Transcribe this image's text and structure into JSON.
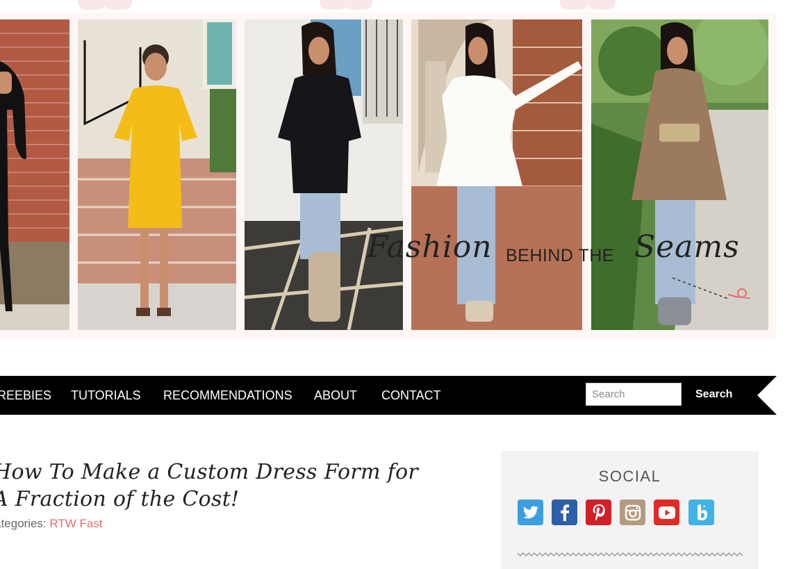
{
  "nav": {
    "items": [
      "REEBIES",
      "TUTORIALS",
      "RECOMMENDATIONS",
      "ABOUT",
      "CONTACT"
    ],
    "search_placeholder": "Search",
    "search_button": "Search"
  },
  "banner": {
    "logo_script_1": "Fashion",
    "logo_middle": "BEHIND THE",
    "logo_script_2": "Seams"
  },
  "post": {
    "title": "How To Make a Custom Dress Form for A Fraction of the Cost!",
    "categories_label": "ategories:",
    "category": "RTW Fast"
  },
  "sidebar": {
    "heading": "SOCIAL",
    "icons": [
      {
        "name": "twitter-icon",
        "color": "#3b9fe0"
      },
      {
        "name": "facebook-icon",
        "color": "#2f5ea8"
      },
      {
        "name": "pinterest-icon",
        "color": "#d0212b"
      },
      {
        "name": "instagram-icon",
        "color": "#b39a80"
      },
      {
        "name": "youtube-icon",
        "color": "#e02a25"
      },
      {
        "name": "bloglovin-icon",
        "color": "#3fb2e6"
      }
    ]
  },
  "colors": {
    "nav_bg": "#000000",
    "accent_link": "#e46b6b",
    "sidebar_bg": "#f3f3f3"
  }
}
